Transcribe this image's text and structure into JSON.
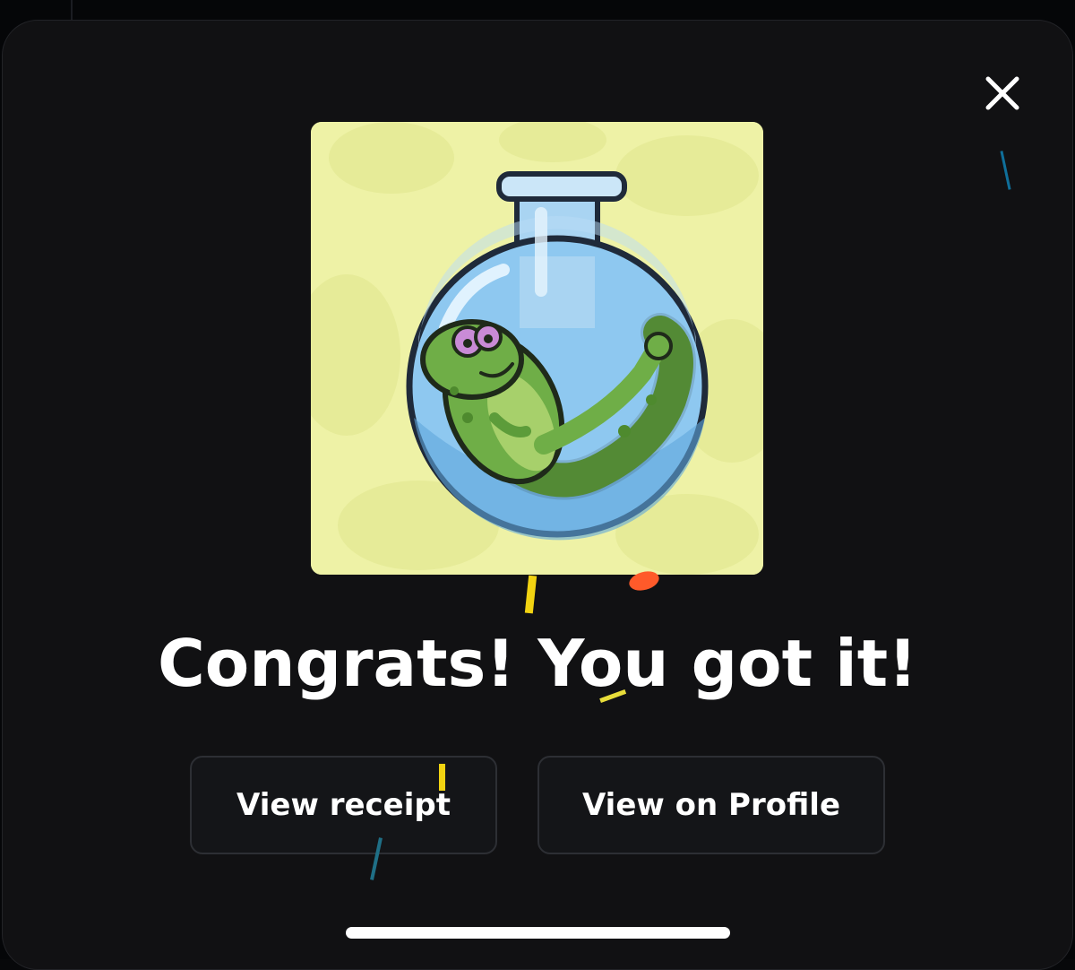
{
  "modal": {
    "headline": "Congrats! You got it!",
    "buttons": {
      "view_receipt": "View receipt",
      "view_profile": "View on Profile"
    },
    "close_icon": "close-icon"
  },
  "nft_image": {
    "icon": "lizard-in-flask-image",
    "background_color": "#eef2a6"
  },
  "colors": {
    "modal_background": "#111113",
    "button_background": "#141518",
    "button_border": "#2d2f34",
    "text": "#ffffff",
    "confetti": [
      "#f2d311",
      "#ff5a2a",
      "#1f6f86",
      "#0f6f9a"
    ]
  }
}
